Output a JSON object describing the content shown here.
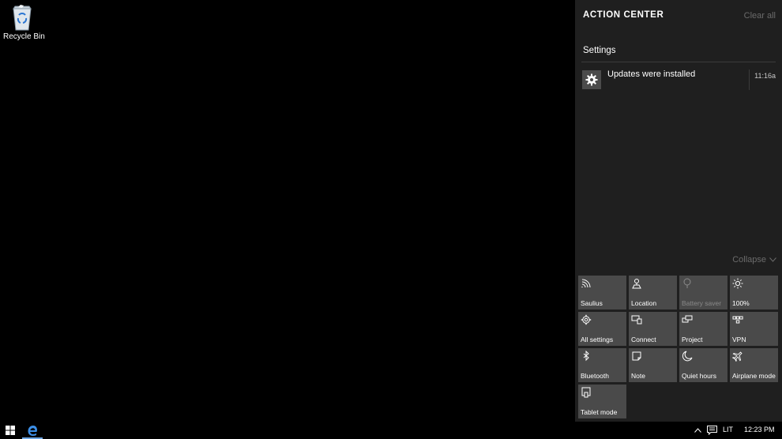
{
  "desktop": {
    "icons": [
      {
        "label": "Recycle Bin",
        "icon": "recycle-bin-icon"
      }
    ]
  },
  "action_center": {
    "title": "ACTION CENTER",
    "clear_all": "Clear all",
    "group": "Settings",
    "notifications": [
      {
        "icon": "gear-icon",
        "text": "Updates were installed",
        "time": "11:16a"
      }
    ],
    "collapse": "Collapse",
    "quick_actions": [
      {
        "label": "Saulius",
        "icon": "wifi-icon",
        "enabled": true
      },
      {
        "label": "Location",
        "icon": "location-icon",
        "enabled": true
      },
      {
        "label": "Battery saver",
        "icon": "battery-saver-icon",
        "enabled": false
      },
      {
        "label": "100%",
        "icon": "brightness-icon",
        "enabled": true
      },
      {
        "label": "All settings",
        "icon": "gear-icon",
        "enabled": true
      },
      {
        "label": "Connect",
        "icon": "connect-icon",
        "enabled": true
      },
      {
        "label": "Project",
        "icon": "project-icon",
        "enabled": true
      },
      {
        "label": "VPN",
        "icon": "vpn-icon",
        "enabled": true
      },
      {
        "label": "Bluetooth",
        "icon": "bluetooth-icon",
        "enabled": true
      },
      {
        "label": "Note",
        "icon": "note-icon",
        "enabled": true
      },
      {
        "label": "Quiet hours",
        "icon": "moon-icon",
        "enabled": true
      },
      {
        "label": "Airplane mode",
        "icon": "airplane-icon",
        "enabled": true
      },
      {
        "label": "Tablet mode",
        "icon": "tablet-icon",
        "enabled": true
      }
    ]
  },
  "taskbar": {
    "start_icon": "windows-logo-icon",
    "pinned": [
      {
        "icon": "edge-browser-icon"
      }
    ],
    "tray": {
      "chevron_icon": "chevron-up-icon",
      "message_icon": "action-center-icon",
      "language": "LIT",
      "time": "12:23 PM"
    }
  },
  "colors": {
    "panel_bg": "#1f1f1f",
    "tile_bg": "#4a4a4a",
    "accent": "#6ea6e3"
  }
}
